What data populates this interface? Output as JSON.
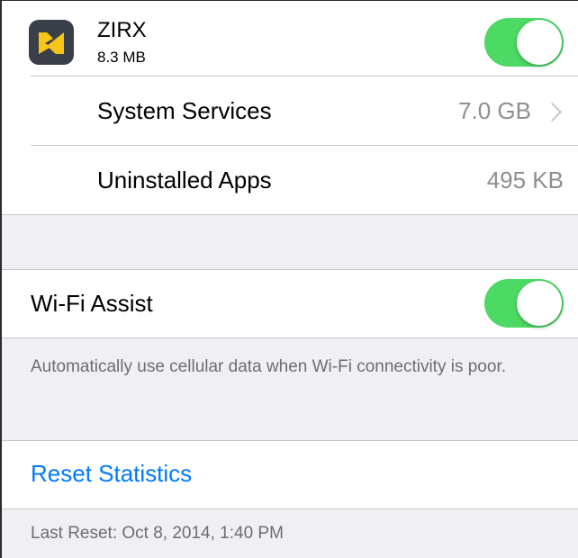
{
  "app_row": {
    "name": "ZIRX",
    "size": "8.3 MB",
    "icon": "zirx-app-icon",
    "toggle_on": true
  },
  "system_services": {
    "label": "System Services",
    "value": "7.0 GB",
    "icon": "chevron-right-icon"
  },
  "uninstalled_apps": {
    "label": "Uninstalled Apps",
    "value": "495 KB"
  },
  "wifi_assist": {
    "label": "Wi-Fi Assist",
    "toggle_on": true,
    "description": "Automatically use cellular data when Wi-Fi connectivity is poor."
  },
  "reset": {
    "label": "Reset Statistics",
    "last_reset": "Last Reset: Oct 8, 2014, 1:40 PM"
  },
  "colors": {
    "background": "#efeff4",
    "toggle_on": "#4cd964",
    "link": "#007aff",
    "secondary_text": "#8e8e93",
    "separator": "#c8c7cc",
    "icon_background": "#3a3f4a",
    "icon_accent": "#f5c518"
  }
}
